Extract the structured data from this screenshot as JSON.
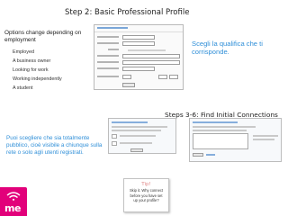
{
  "step2": {
    "title": "Step 2: Basic Professional Profile",
    "options_heading": "Options change depending on employment",
    "options": [
      "Employed",
      "A business owner",
      "Looking for work",
      "Working independently",
      "A student"
    ],
    "note": "Scegli la qualifica che ti corrisponde."
  },
  "steps36": {
    "title": "Steps 3-6: Find Initial Connections",
    "note": "Puoi scegliere che sia totalmente pubblico, cioè visibile a chiunque sulla rete o solo agli utenti registrati."
  },
  "tip": {
    "title": "Tip!",
    "body": "Skip it. Why connect before you have set up your profile?"
  },
  "logo": {
    "text": "me",
    "color": "#e2007a"
  },
  "colors": {
    "note_blue": "#2f8fd8",
    "tip_title": "#e08a8a"
  }
}
